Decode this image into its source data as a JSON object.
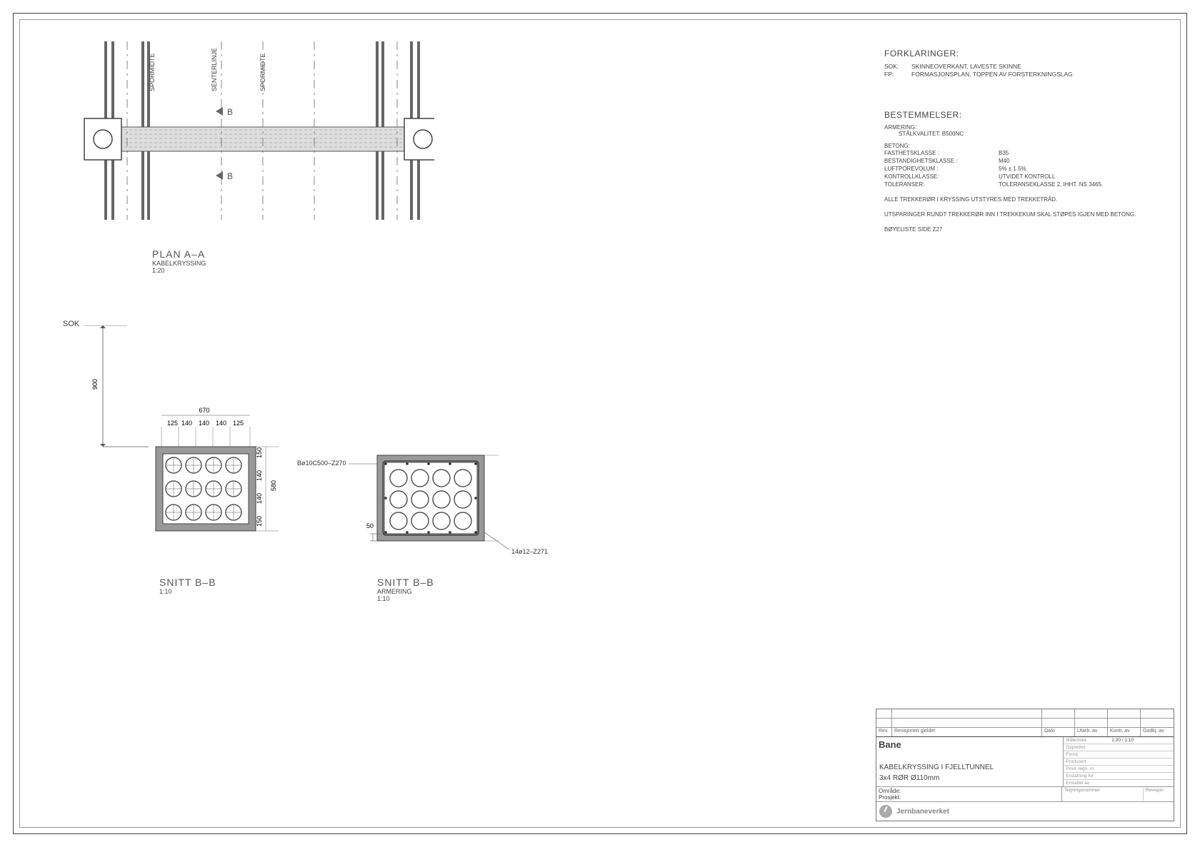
{
  "plan": {
    "title": "PLAN A–A",
    "subtitle": "KABELKRYSSING",
    "scale": "1:20",
    "axis_labels": [
      "SPORMIDTE",
      "SENTERLINJE",
      "SPORMIDTE"
    ],
    "section_marker": "B"
  },
  "sok": "SOK",
  "section_bb_left": {
    "title": "SNITT B–B",
    "scale": "1:10",
    "dim_900": "900",
    "dim_670": "670",
    "dims_top": [
      "125",
      "140",
      "140",
      "140",
      "125"
    ],
    "dims_right": [
      "150",
      "140",
      "140",
      "150"
    ],
    "dim_580": "580"
  },
  "section_bb_right": {
    "title": "SNITT B–B",
    "subtitle": "ARMERING",
    "scale": "1:10",
    "rebar_label_left": "Bø10C500–Z270",
    "dim_50": "50",
    "rebar_label_right": "14ø12–Z271"
  },
  "notes": {
    "forklaringer": {
      "heading": "FORKLARINGER:",
      "rows": [
        {
          "k": "SOK:",
          "v": "SKINNEOVERKANT, LAVESTE SKINNE"
        },
        {
          "k": "FP:",
          "v": "FORMASJONSPLAN, TOPPEN AV FORSTERKNINGSLAG"
        }
      ]
    },
    "bestemmelser": {
      "heading": "BESTEMMELSER:",
      "armering_label": "ARMERING:",
      "armering_val": "STÅLKVALITET: B500NC",
      "betong_label": "BETONG:",
      "specs": [
        {
          "k": "FASTHETSKLASSE :",
          "v": "B35"
        },
        {
          "k": "BESTANDIGHETSKLASSE :",
          "v": "M40"
        },
        {
          "k": "LUFTPOREVOLUM :",
          "v": "5% ± 1.5%"
        },
        {
          "k": "KONTROLLKLASSE:",
          "v": "UTVIDET KONTROLL"
        },
        {
          "k": "TOLERANSER:",
          "v": "TOLERANSEKLASSE 2, IHHT. NS 3465."
        }
      ],
      "free": [
        "ALLE TREKKERØR I KRYSSING UTSTYRES MED TREKKETRÅD.",
        "UTSPARINGER RUNDT TREKKERØR INN I TREKKEKUM SKAL STØPES IGJEN MED BETONG.",
        "BØYELISTE SIDE Z27"
      ]
    }
  },
  "titleblock": {
    "rev_header": [
      "Rev.",
      "Revisjonen gjelder",
      "Dato",
      "Utarb. av",
      "Kontr. av",
      "Godkj. av"
    ],
    "bane_label": "Bane",
    "line1": "KABELKRYSSING I FJELLTUNNEL",
    "line2": "3x4 RØR Ø110mm",
    "omrade": "Område:",
    "prosjekt": "Prosjekt:",
    "org": "Jernbaneverket",
    "right_minis": [
      "Målestokk",
      "Opprettet",
      "Firma",
      "Produsert",
      "Prod. tegn. nr.",
      "Erstatning for",
      "Erstattet av"
    ],
    "right_vals": [
      "1:20 / 1:10",
      "",
      "",
      "",
      "",
      "",
      ""
    ],
    "tegnum_label": "Tegningsnummer",
    "rev_label": "Revisjon"
  }
}
